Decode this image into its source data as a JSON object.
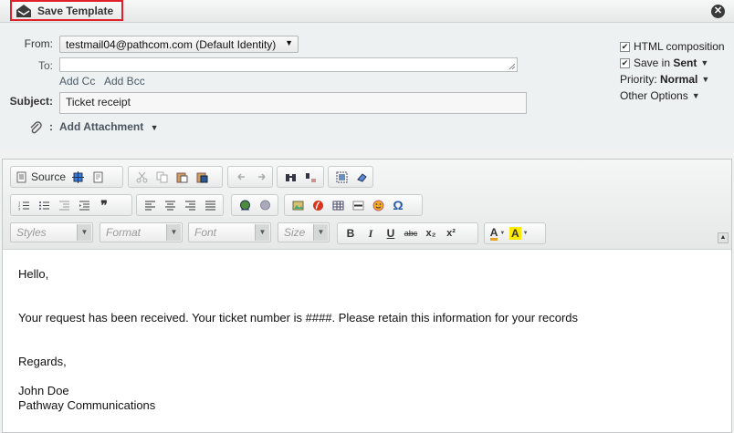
{
  "topbar": {
    "save_label": "Save Template"
  },
  "compose": {
    "from_label": "From:",
    "from_value": "testmail04@pathcom.com (Default Identity)",
    "to_label": "To:",
    "to_value": "",
    "add_cc": "Add Cc",
    "add_bcc": "Add Bcc",
    "subject_label": "Subject:",
    "subject_value": "Ticket receipt",
    "attach_colon": ":",
    "add_attachment": "Add Attachment"
  },
  "options": {
    "html_composition": "HTML composition",
    "save_in_prefix": "Save in",
    "save_in_folder": "Sent",
    "priority_label": "Priority:",
    "priority_value": "Normal",
    "other_options": "Other Options"
  },
  "toolbar": {
    "source_label": "Source",
    "styles_placeholder": "Styles",
    "format_placeholder": "Format",
    "font_placeholder": "Font",
    "size_placeholder": "Size",
    "bold": "B",
    "italic": "I",
    "underline": "U",
    "strike": "abc",
    "subscript": "x₂",
    "superscript": "x²",
    "text_color": "A",
    "bg_color": "A"
  },
  "body": {
    "greeting": "Hello,",
    "message": "Your request has been received. Your ticket number is ####. Please retain this information for your records",
    "closing": "Regards,",
    "name": "John Doe",
    "company": "Pathway Communications"
  }
}
